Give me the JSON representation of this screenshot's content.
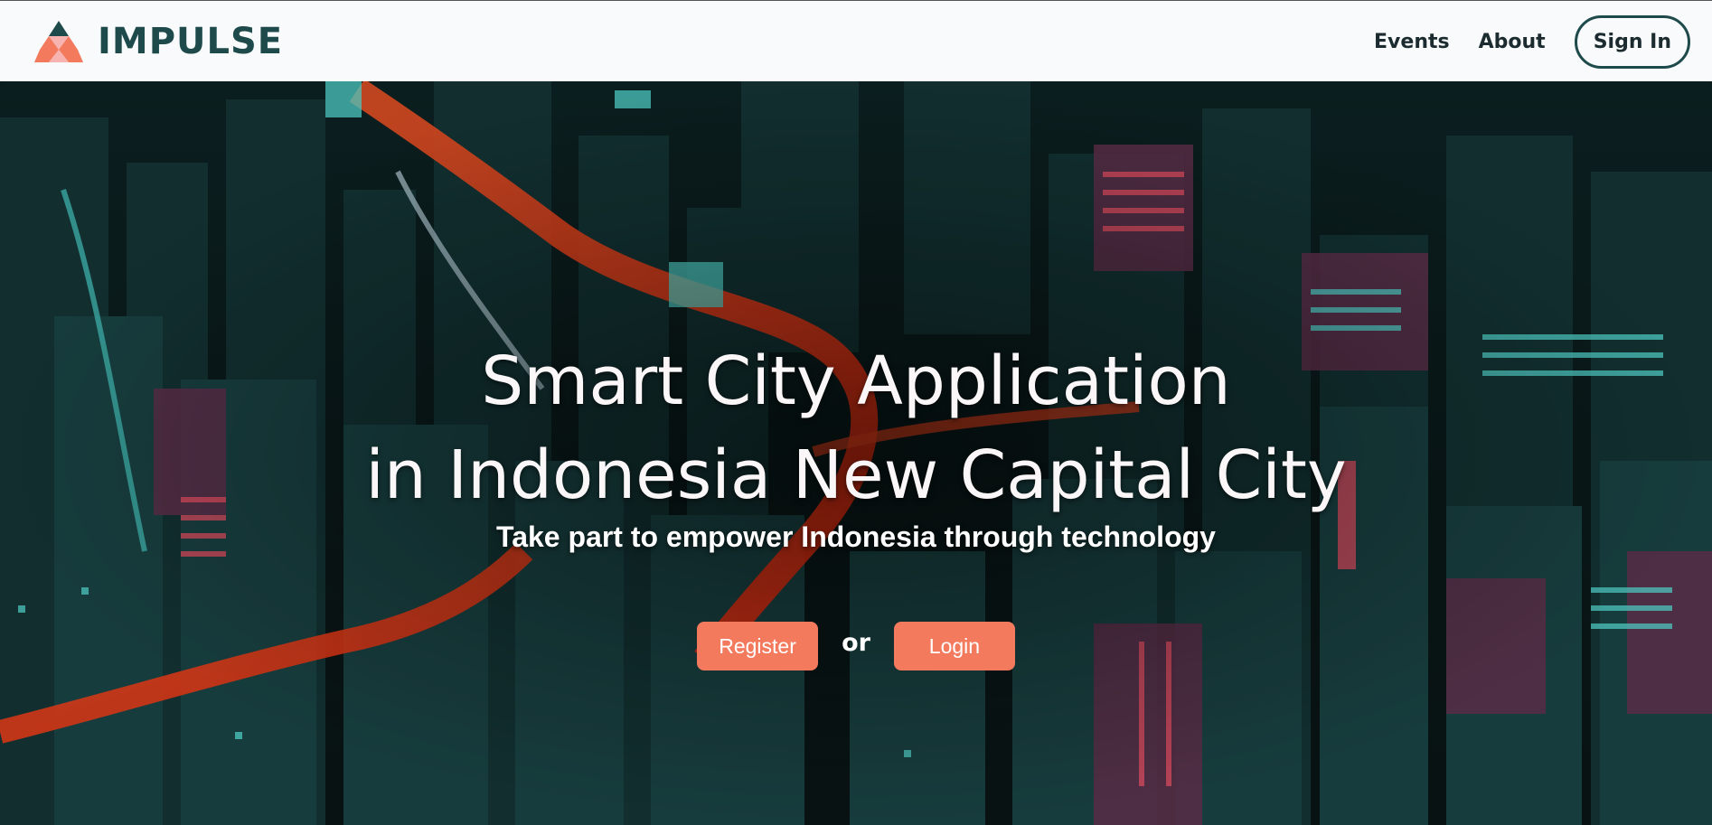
{
  "brand": {
    "name": "IMPULSE",
    "logo_icon": "triangle-logo-icon"
  },
  "nav": {
    "events": "Events",
    "about": "About",
    "sign_in": "Sign In"
  },
  "hero": {
    "headline_line1": "Smart City Application",
    "headline_line2": "in Indonesia New Capital City",
    "subheadline": "Take part to empower Indonesia through technology",
    "register_label": "Register",
    "or_label": "or",
    "login_label": "Login"
  },
  "colors": {
    "brand": "#1f4a4c",
    "accent": "#f47a5e",
    "topbar_bg": "#f8fafb"
  }
}
